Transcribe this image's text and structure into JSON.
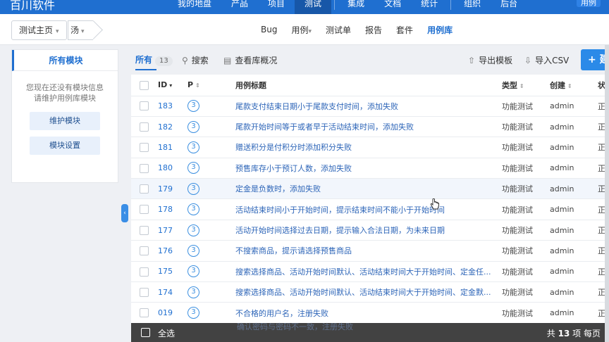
{
  "topbar": {
    "brand": "百川软件",
    "nav": [
      "我的地盘",
      "产品",
      "项目",
      "测试",
      "集成",
      "文档",
      "统计",
      "组织",
      "后台"
    ],
    "active_nav": "测试",
    "user": "用例"
  },
  "subbar": {
    "crumb_home": "测试主页",
    "crumb_current": "汤",
    "menu": [
      {
        "label": "Bug",
        "dropdown": false
      },
      {
        "label": "用例",
        "dropdown": true
      },
      {
        "label": "测试单",
        "dropdown": false
      },
      {
        "label": "报告",
        "dropdown": false
      },
      {
        "label": "套件",
        "dropdown": false
      },
      {
        "label": "用例库",
        "dropdown": false,
        "active": true
      }
    ]
  },
  "sidebar": {
    "title": "所有模块",
    "empty_line1": "您现在还没有模块信息",
    "empty_line2": "请维护用例库模块",
    "btn_maintain": "维护模块",
    "btn_settings": "模块设置"
  },
  "toolbar": {
    "tab_all": "所有",
    "tab_count": "13",
    "search": "搜索",
    "overview": "查看库概况",
    "export_template": "导出模板",
    "import_csv": "导入CSV",
    "create": "+ 建"
  },
  "table": {
    "headers": {
      "id": "ID",
      "p": "P",
      "title": "用例标题",
      "type": "类型",
      "created_by": "创建",
      "status": "状"
    },
    "rows": [
      {
        "id": "183",
        "p": "3",
        "title": "尾款支付结束日期小于尾款支付时间，添加失败",
        "type": "功能测试",
        "by": "admin",
        "st": "正"
      },
      {
        "id": "182",
        "p": "3",
        "title": "尾款开始时间等于或者早于活动结束时间，添加失败",
        "type": "功能测试",
        "by": "admin",
        "st": "正"
      },
      {
        "id": "181",
        "p": "3",
        "title": "赠送积分是付积分时添加积分失败",
        "type": "功能测试",
        "by": "admin",
        "st": "正"
      },
      {
        "id": "180",
        "p": "3",
        "title": "预售库存小于预订人数，添加失败",
        "type": "功能测试",
        "by": "admin",
        "st": "正"
      },
      {
        "id": "179",
        "p": "3",
        "title": "定金是负数时，添加失败",
        "type": "功能测试",
        "by": "admin",
        "st": "正"
      },
      {
        "id": "178",
        "p": "3",
        "title": "活动结束时间小于开始时间，提示结束时间不能小于开始时间",
        "type": "功能测试",
        "by": "admin",
        "st": "正"
      },
      {
        "id": "177",
        "p": "3",
        "title": "活动开始时间选择过去日期，提示输入合法日期，为未来日期",
        "type": "功能测试",
        "by": "admin",
        "st": "正"
      },
      {
        "id": "176",
        "p": "3",
        "title": "不搜索商品，提示请选择预售商品",
        "type": "功能测试",
        "by": "admin",
        "st": "正"
      },
      {
        "id": "175",
        "p": "3",
        "title": "搜索选择商品、活动开始时间默认、活动结束时间大于开始时间、定金任...",
        "type": "功能测试",
        "by": "admin",
        "st": "正"
      },
      {
        "id": "174",
        "p": "3",
        "title": "搜索选择商品、活动开始时间默认、活动结束时间大于开始时间、定金默...",
        "type": "功能测试",
        "by": "admin",
        "st": "正"
      },
      {
        "id": "019",
        "p": "3",
        "title": "不合格的用户名，注册失败",
        "type": "功能测试",
        "by": "admin",
        "st": "正"
      }
    ]
  },
  "footer": {
    "select_all": "全选",
    "partial_row": "确认密码与密码不一致，注册失败",
    "total_prefix": "共",
    "total_count": "13",
    "total_suffix": "项  每页"
  }
}
